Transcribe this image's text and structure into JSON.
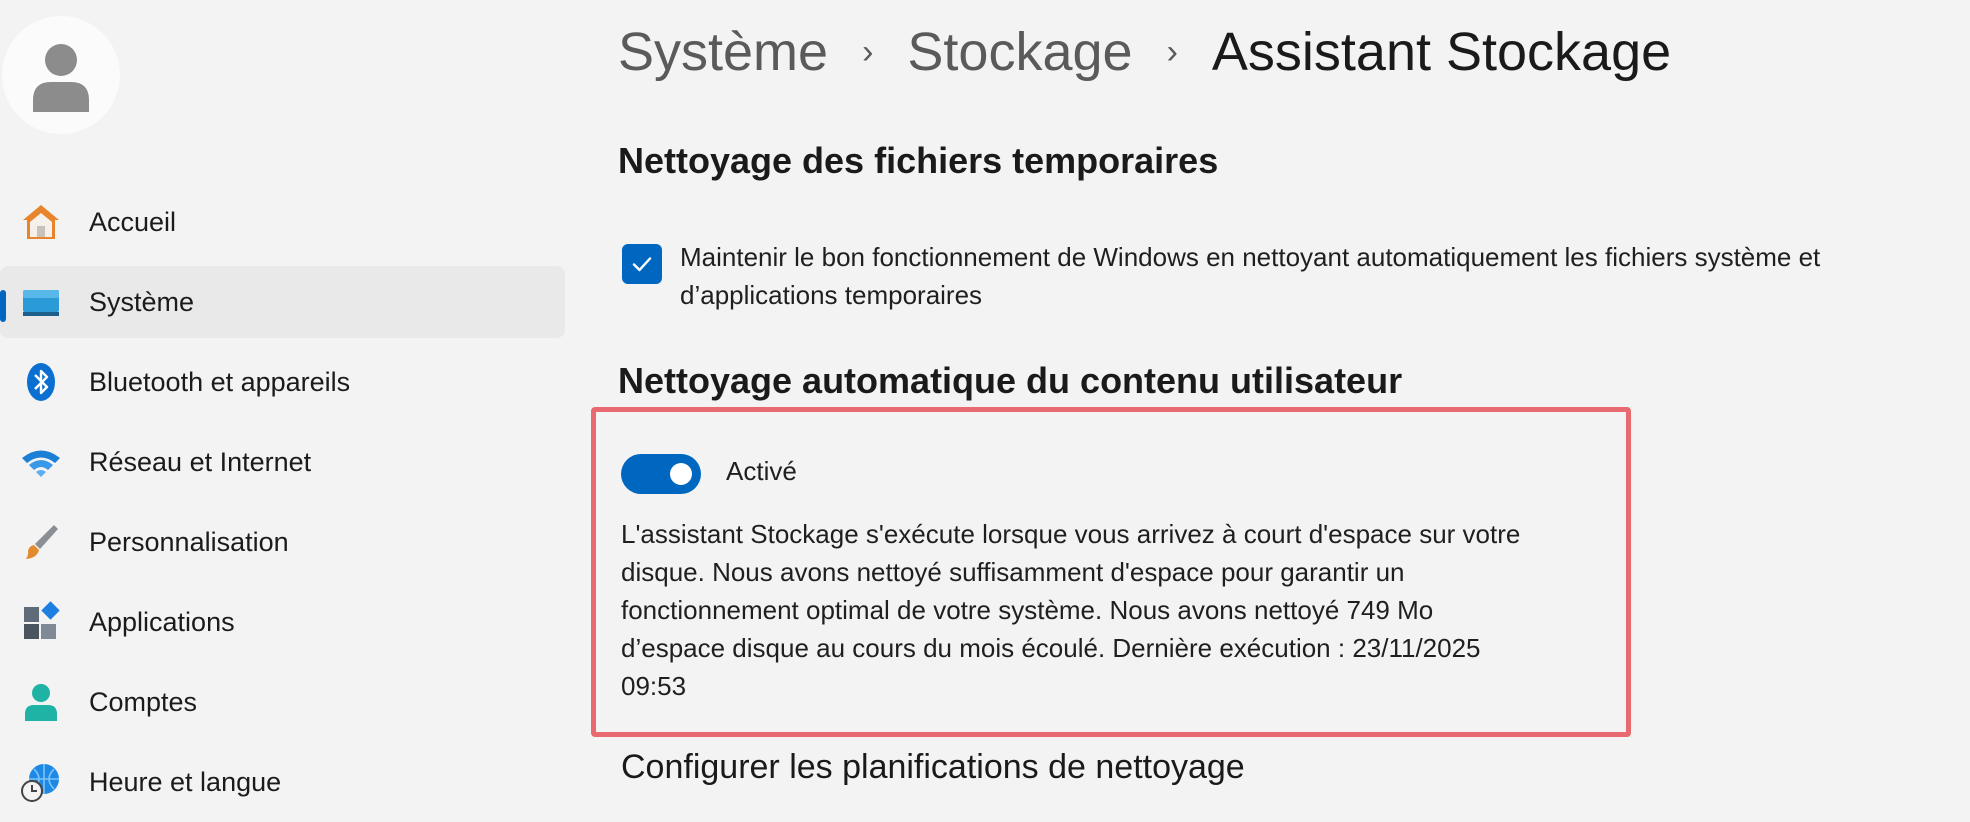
{
  "sidebar": {
    "items": [
      {
        "label": "Accueil",
        "icon": "home-icon"
      },
      {
        "label": "Système",
        "icon": "system-icon",
        "active": true
      },
      {
        "label": "Bluetooth et appareils",
        "icon": "bluetooth-icon"
      },
      {
        "label": "Réseau et Internet",
        "icon": "wifi-icon"
      },
      {
        "label": "Personnalisation",
        "icon": "brush-icon"
      },
      {
        "label": "Applications",
        "icon": "apps-icon"
      },
      {
        "label": "Comptes",
        "icon": "account-icon"
      },
      {
        "label": "Heure et langue",
        "icon": "time-language-icon"
      }
    ]
  },
  "breadcrumb": {
    "items": [
      "Système",
      "Stockage",
      "Assistant Stockage"
    ],
    "separator": "›"
  },
  "temp_files": {
    "heading": "Nettoyage des fichiers temporaires",
    "checkbox_checked": true,
    "checkbox_label": "Maintenir le bon fonctionnement de Windows en nettoyant automatiquement les fichiers système et d’applications temporaires"
  },
  "auto_cleanup": {
    "heading": "Nettoyage automatique du contenu utilisateur",
    "toggle_on": true,
    "toggle_label": "Activé",
    "description": "L'assistant Stockage s'exécute lorsque vous arrivez à court d'espace sur votre disque. Nous avons nettoyé suffisamment d'espace pour garantir un fonctionnement optimal de votre système. Nous avons nettoyé 749 Mo d’espace disque au cours du mois écoulé. Dernière exécution : 23/11/2025 09:53"
  },
  "schedule": {
    "label": "Configurer les planifications de nettoyage"
  },
  "colors": {
    "accent": "#0067c0",
    "highlight_border": "#e8696f",
    "background": "#f3f3f3"
  }
}
